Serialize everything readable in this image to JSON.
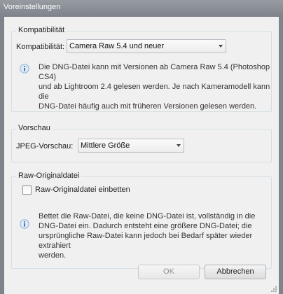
{
  "window": {
    "title": "Voreinstellungen"
  },
  "compat": {
    "group_title": "Kompatibilität",
    "label": "Kompatibilität:",
    "selected": "Camera Raw 5.4 und neuer",
    "info_lines": [
      "Die DNG-Datei kann mit Versionen ab Camera Raw 5.4 (Photoshop CS4)",
      "und ab Lightroom 2.4 gelesen werden. Je nach Kameramodell kann die",
      "DNG-Datei häufig auch mit früheren Versionen gelesen werden."
    ]
  },
  "preview": {
    "group_title": "Vorschau",
    "label": "JPEG-Vorschau:",
    "selected": "Mittlere Größe"
  },
  "raw": {
    "group_title": "Raw-Originaldatei",
    "checkbox_label": "Raw-Originaldatei einbetten",
    "checked": false,
    "info_lines": [
      "Bettet die Raw-Datei, die keine DNG-Datei ist, vollständig in die",
      "DNG-Datei ein. Dadurch entsteht eine größere DNG-Datei; die",
      "ursprüngliche Raw-Datei kann jedoch bei Bedarf später wieder extrahiert",
      "werden."
    ]
  },
  "buttons": {
    "ok": "OK",
    "cancel": "Abbrechen",
    "ok_disabled": true
  },
  "icons": {
    "info": "info-icon",
    "dropdown": "chevron-down-icon",
    "resize": "resize-grip-icon"
  }
}
